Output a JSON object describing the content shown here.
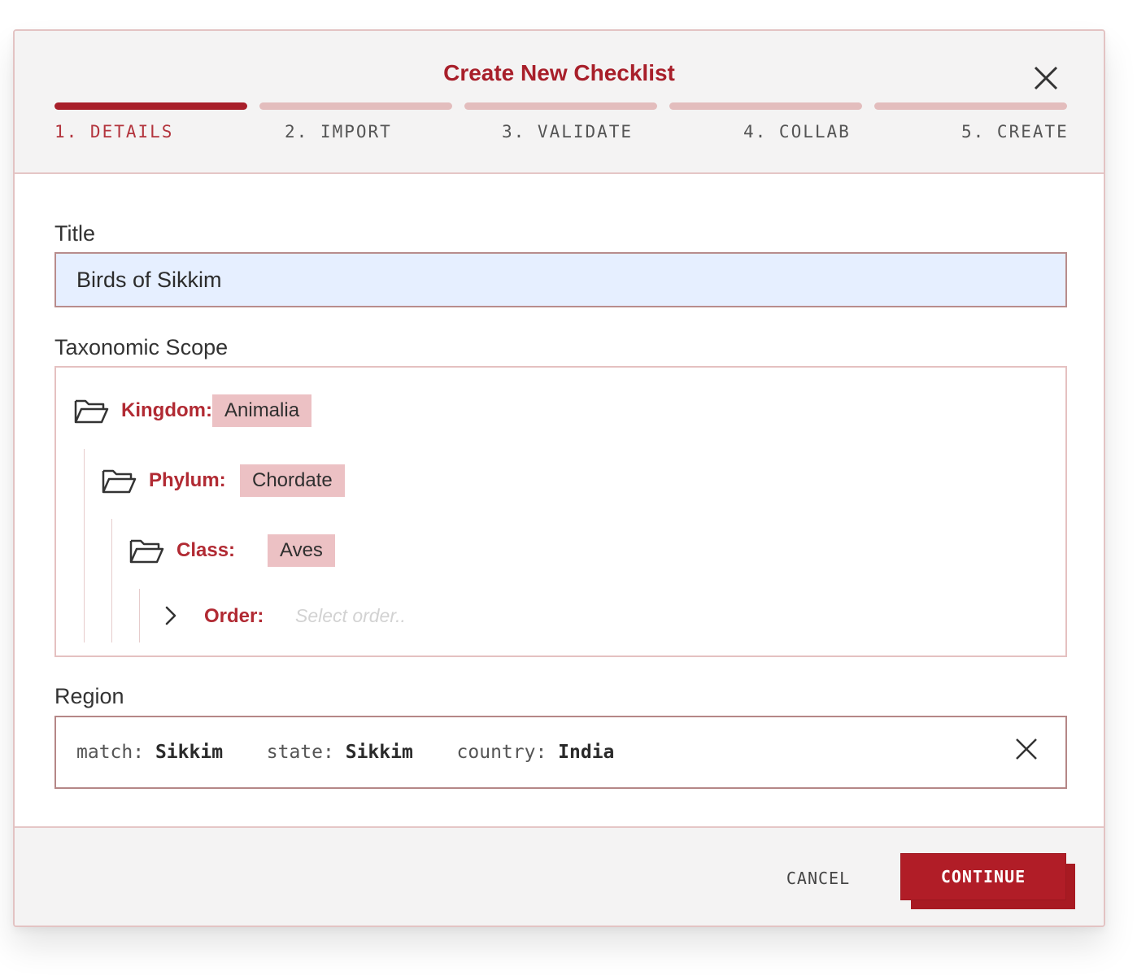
{
  "dialog": {
    "title": "Create New Checklist"
  },
  "steps": [
    {
      "label": "1. DETAILS",
      "active": true
    },
    {
      "label": "2. IMPORT",
      "active": false
    },
    {
      "label": "3. VALIDATE",
      "active": false
    },
    {
      "label": "4. COLLAB",
      "active": false
    },
    {
      "label": "5. CREATE",
      "active": false
    }
  ],
  "form": {
    "title_label": "Title",
    "title_value": "Birds of Sikkim",
    "scope_label": "Taxonomic Scope",
    "tree": {
      "kingdom": {
        "label": "Kingdom:",
        "value": "Animalia"
      },
      "phylum": {
        "label": "Phylum:",
        "value": "Chordate"
      },
      "class": {
        "label": "Class:",
        "value": "Aves"
      },
      "order": {
        "label": "Order:",
        "placeholder": "Select order.."
      }
    },
    "region_label": "Region",
    "region": {
      "match_key": "match:",
      "match_value": "Sikkim",
      "state_key": "state:",
      "state_value": "Sikkim",
      "country_key": "country:",
      "country_value": "India"
    }
  },
  "footer": {
    "cancel_label": "CANCEL",
    "continue_label": "CONTINUE"
  },
  "colors": {
    "accent": "#a81f2a",
    "chip": "#ecc1c4",
    "input_bg": "#e6efff"
  },
  "icons": [
    "close-icon",
    "folder-open-icon",
    "chevron-right-icon",
    "clear-icon"
  ]
}
